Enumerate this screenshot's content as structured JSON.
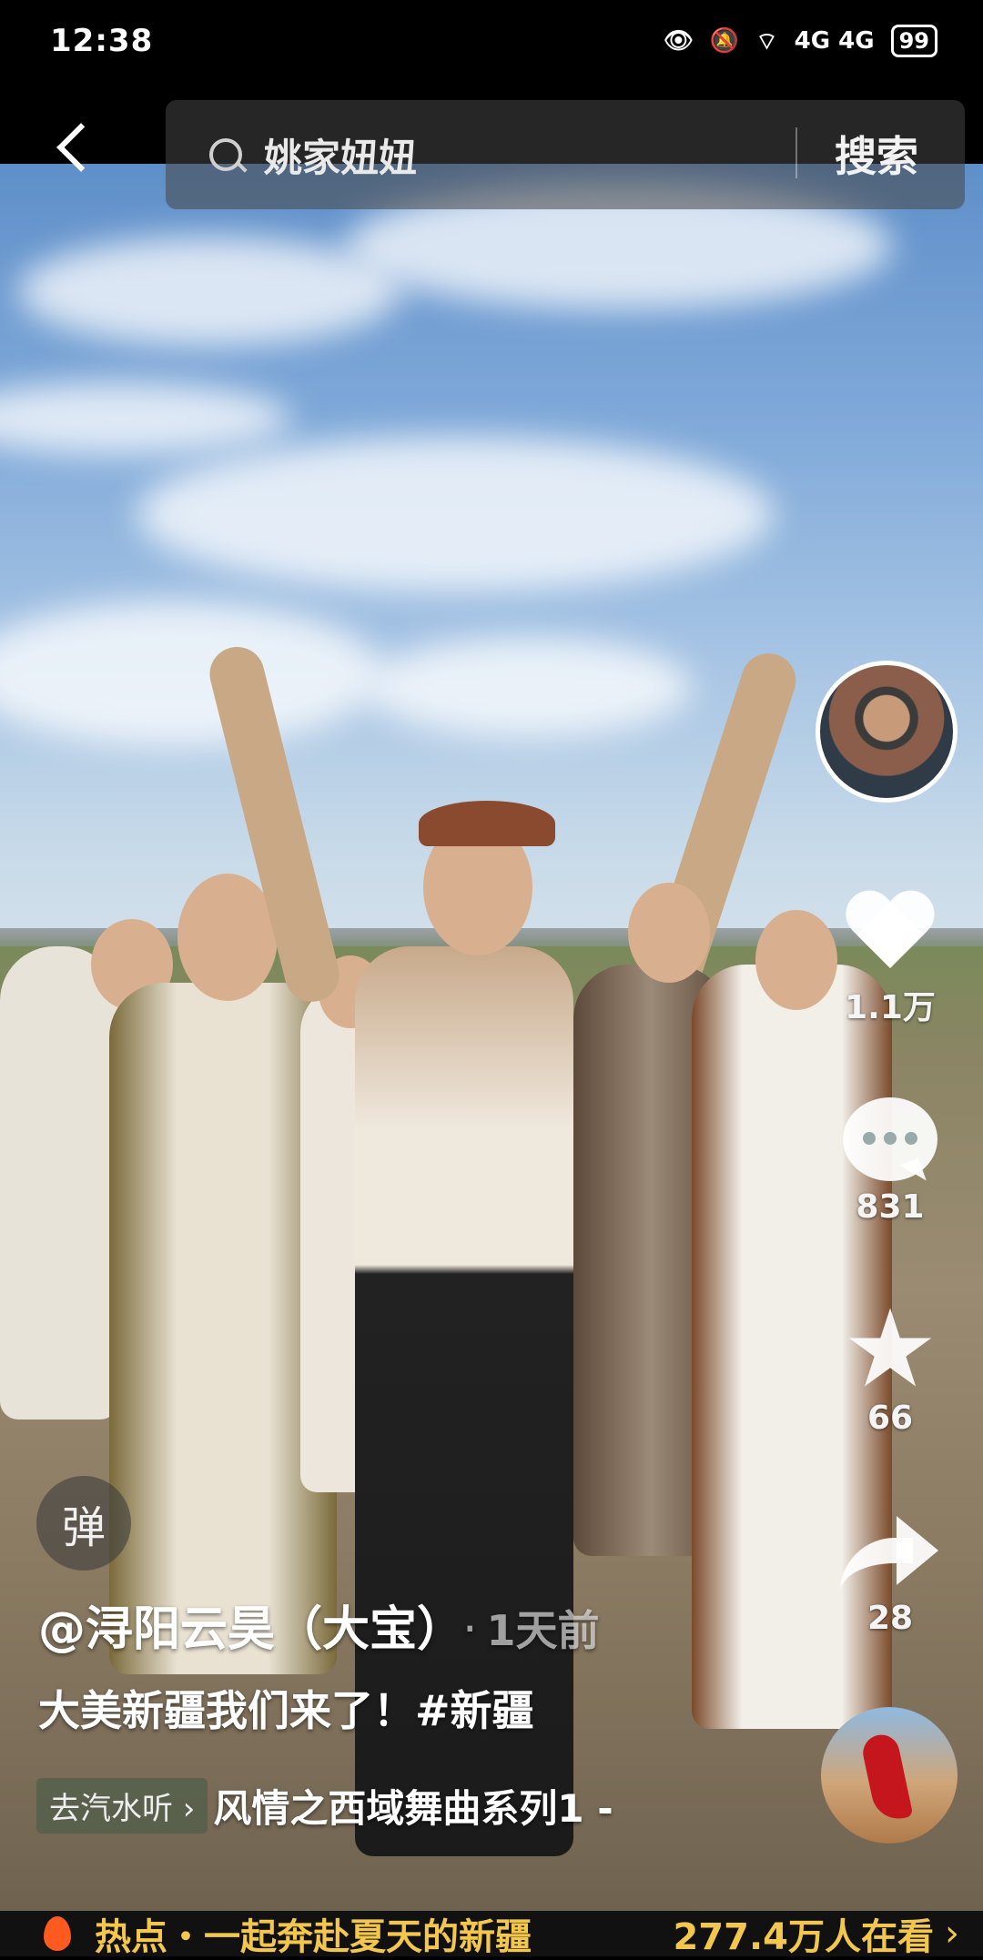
{
  "status_bar": {
    "time": "12:38",
    "network": "4G 4G",
    "battery": "99"
  },
  "search": {
    "query": "姚家妞妞",
    "button": "搜索"
  },
  "actions": {
    "likes": "1.1万",
    "comments": "831",
    "favorites": "66",
    "shares": "28"
  },
  "danmu": {
    "label": "弹"
  },
  "post": {
    "author": "@浔阳云昊（大宝）",
    "separator": "·",
    "time_ago": "1天前",
    "caption": "大美新疆我们来了！#新疆"
  },
  "music": {
    "chip": "去汽水听 ›",
    "title": "风情之西域舞曲系列1 -"
  },
  "hot": {
    "text": "热点・一起奔赴夏天的新疆",
    "count": "277.4万人在看",
    "chevron": "›"
  },
  "colors": {
    "accent": "#f3c64d",
    "flame": "#ff5a1f"
  }
}
